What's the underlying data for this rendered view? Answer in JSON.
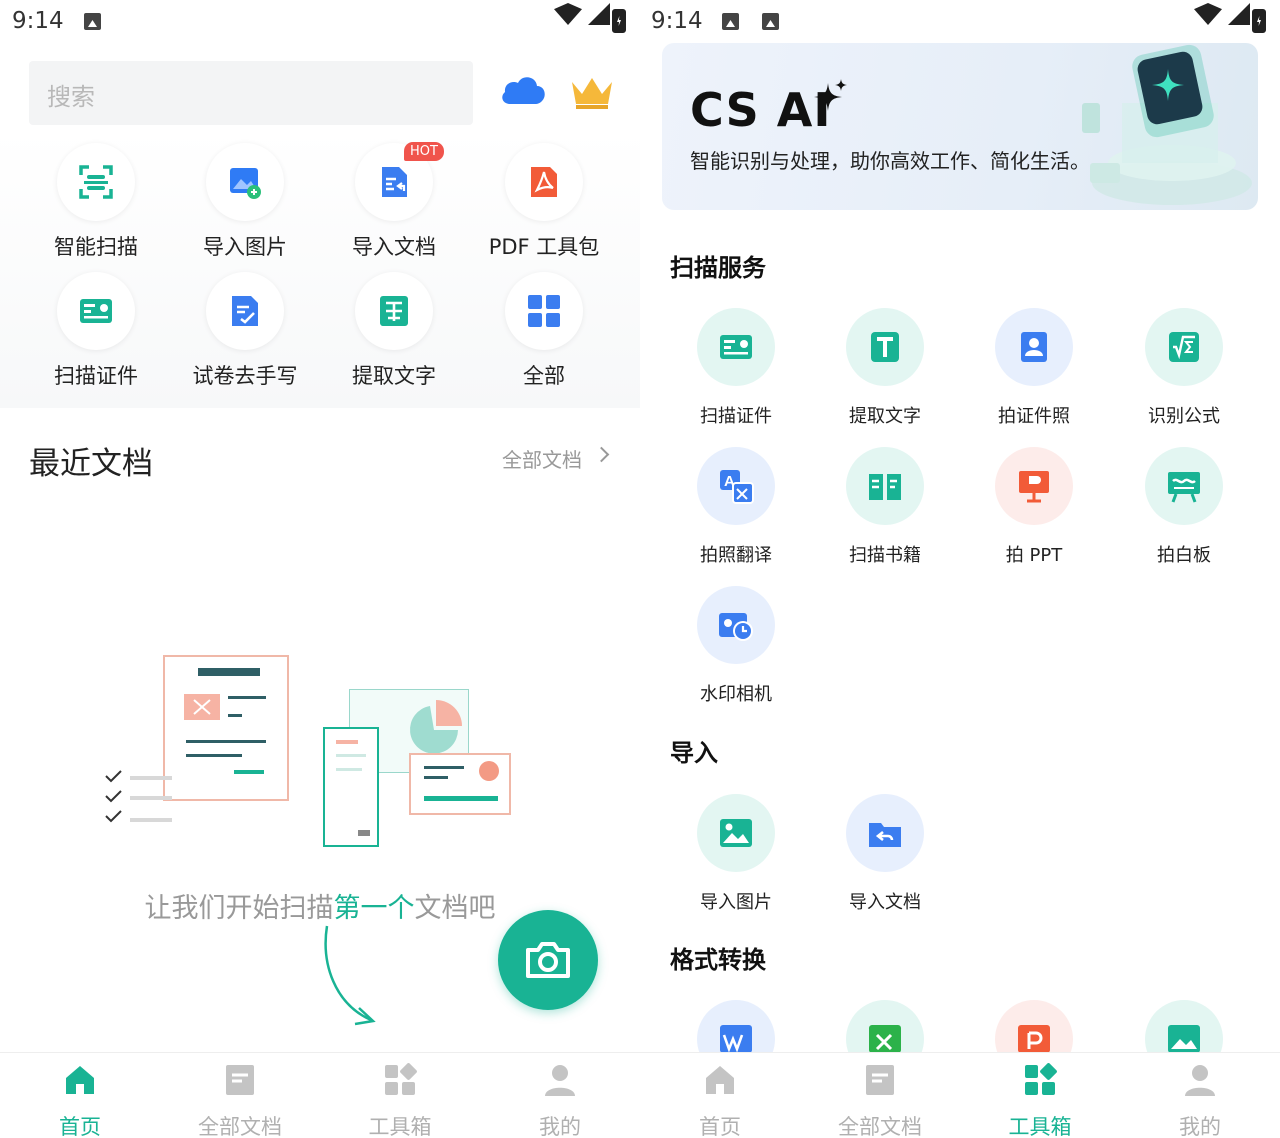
{
  "left": {
    "status": {
      "time": "9:14"
    },
    "search": {
      "placeholder": "搜索"
    },
    "tools": [
      {
        "label": "智能扫描",
        "icon": "smart-scan-icon"
      },
      {
        "label": "导入图片",
        "icon": "import-image-icon"
      },
      {
        "label": "导入文档",
        "icon": "import-doc-icon",
        "badge": "HOT"
      },
      {
        "label": "PDF 工具包",
        "icon": "pdf-toolkit-icon"
      },
      {
        "label": "扫描证件",
        "icon": "id-card-icon"
      },
      {
        "label": "试卷去手写",
        "icon": "remove-handwriting-icon"
      },
      {
        "label": "提取文字",
        "icon": "extract-text-icon"
      },
      {
        "label": "全部",
        "icon": "all-tools-icon"
      }
    ],
    "recent": {
      "title": "最近文档",
      "all_link": "全部文档"
    },
    "empty": {
      "prefix": "让我们开始扫描",
      "highlight": "第一个",
      "suffix": "文档吧"
    },
    "tabs": [
      {
        "label": "首页",
        "icon": "home-icon",
        "active": true
      },
      {
        "label": "全部文档",
        "icon": "documents-icon",
        "active": false
      },
      {
        "label": "工具箱",
        "icon": "toolbox-icon",
        "active": false
      },
      {
        "label": "我的",
        "icon": "profile-icon",
        "active": false
      }
    ]
  },
  "right": {
    "status": {
      "time": "9:14"
    },
    "banner": {
      "title": "CS AI",
      "subtitle": "智能识别与处理，助你高效工作、简化生活。"
    },
    "sections": {
      "scan": {
        "title": "扫描服务",
        "items": [
          {
            "label": "扫描证件",
            "icon": "id-card-icon"
          },
          {
            "label": "提取文字",
            "icon": "extract-text-icon"
          },
          {
            "label": "拍证件照",
            "icon": "id-photo-icon"
          },
          {
            "label": "识别公式",
            "icon": "formula-icon"
          },
          {
            "label": "拍照翻译",
            "icon": "translate-icon"
          },
          {
            "label": "扫描书籍",
            "icon": "book-scan-icon"
          },
          {
            "label": "拍 PPT",
            "icon": "ppt-capture-icon"
          },
          {
            "label": "拍白板",
            "icon": "whiteboard-icon"
          },
          {
            "label": "水印相机",
            "icon": "watermark-camera-icon"
          }
        ]
      },
      "import": {
        "title": "导入",
        "items": [
          {
            "label": "导入图片",
            "icon": "import-image-icon"
          },
          {
            "label": "导入文档",
            "icon": "import-doc-icon"
          }
        ]
      },
      "convert": {
        "title": "格式转换"
      }
    },
    "tabs": [
      {
        "label": "首页",
        "icon": "home-icon",
        "active": false
      },
      {
        "label": "全部文档",
        "icon": "documents-icon",
        "active": false
      },
      {
        "label": "工具箱",
        "icon": "toolbox-icon",
        "active": true
      },
      {
        "label": "我的",
        "icon": "profile-icon",
        "active": false
      }
    ]
  },
  "colors": {
    "accent": "#19b394",
    "hot": "#f0544c",
    "muted": "#b0b0b0"
  }
}
